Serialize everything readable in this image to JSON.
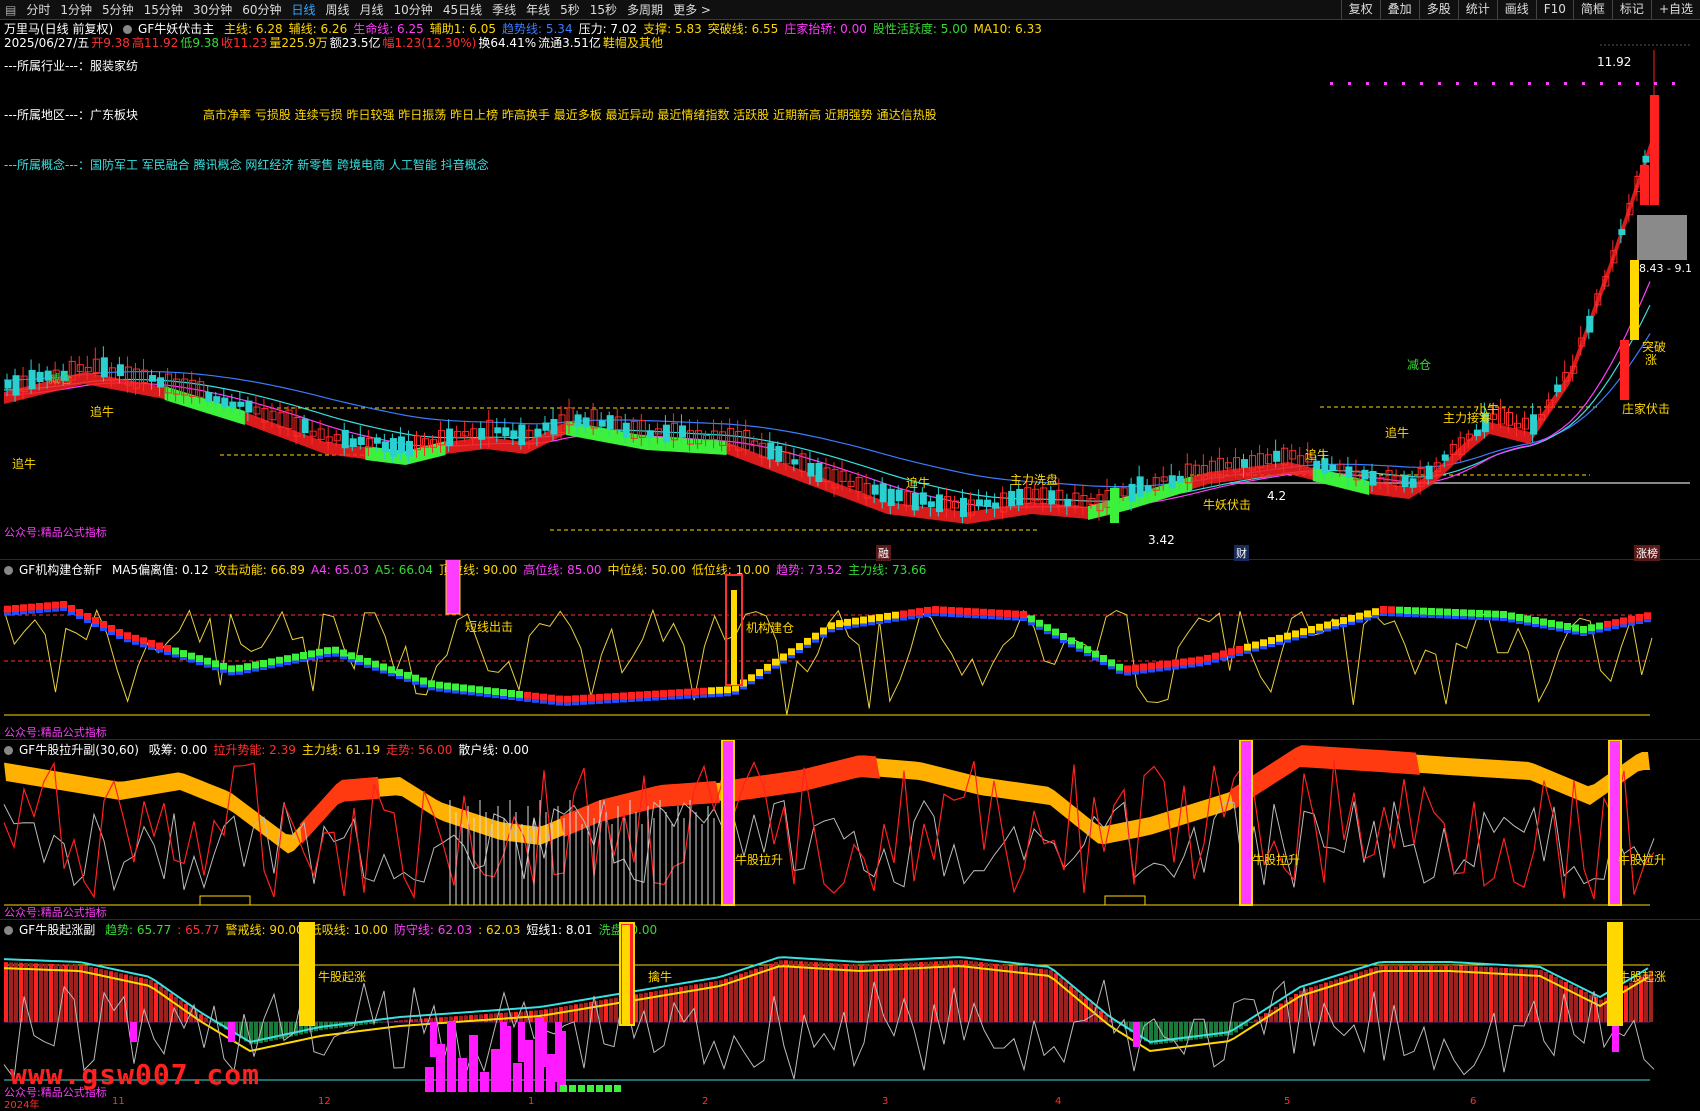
{
  "toolbar": {
    "periods": [
      "分时",
      "1分钟",
      "5分钟",
      "15分钟",
      "30分钟",
      "60分钟",
      "日线",
      "周线",
      "月线",
      "10分钟",
      "45日线",
      "季线",
      "年线",
      "5秒",
      "15秒",
      "多周期",
      "更多 >"
    ],
    "active_period": "日线",
    "right_buttons": [
      "复权",
      "叠加",
      "多股",
      "统计",
      "画线",
      "F10",
      "简框",
      "标记",
      "+自选"
    ]
  },
  "header": {
    "stock": "万里马(日线 前复权)",
    "indicator": "GF牛妖伏击主",
    "items": [
      {
        "label": "主线: 6.28",
        "color": "#ffd800"
      },
      {
        "label": "辅线: 6.26",
        "color": "#ffd800"
      },
      {
        "label": "生命线: 6.25",
        "color": "#ff3cff"
      },
      {
        "label": "辅助1: 6.05",
        "color": "#ffd800"
      },
      {
        "label": "趋势线: 5.34",
        "color": "#3a7cff"
      },
      {
        "label": "压力: 7.02",
        "color": "#ffffff"
      },
      {
        "label": "支撑: 5.83",
        "color": "#ffd800"
      },
      {
        "label": "突破线: 6.55",
        "color": "#ffd800"
      },
      {
        "label": "庄家抬轿: 0.00",
        "color": "#ff3cff"
      },
      {
        "label": "股性活跃度: 5.00",
        "color": "#36d936"
      },
      {
        "label": "MA10: 6.33",
        "color": "#ffd800"
      }
    ]
  },
  "quote": {
    "date": "2025/06/27/五",
    "open": "开9.38",
    "high": "高11.92",
    "low": "低9.38",
    "close": "收11.23",
    "volume": "量225.9万",
    "amount": "额23.5亿",
    "change": "幅1.23(12.30%)",
    "turnover": "换64.41%",
    "float": "流通3.51亿",
    "concept_tag": "鞋帽及其他"
  },
  "info_rows": {
    "industry_label": "---所属行业---：",
    "industry": "服装家纺",
    "region_label": "---所属地区---：",
    "region": "广东板块",
    "region_tags": "高市净率 亏损股 连续亏损 昨日较强 昨日振荡 昨日上榜 昨高换手 最近多板 最近异动 最近情绪指数 活跃股 近期新高 近期强势 通达信热股",
    "concept_label": "---所属概念---：",
    "concept": "国防军工 军民融合 腾讯概念 网红经济 新零售 跨境电商 人工智能 抖音概念"
  },
  "main_chart": {
    "price_high": "11.92",
    "price_low": "3.42",
    "low_mark": "4.2",
    "box_range": "8.43 - 9.1",
    "watermark": "公众号:精品公式指标",
    "signals": [
      "追牛",
      "追牛",
      "追牛",
      "牛妖伏击",
      "追牛",
      "追牛",
      "主力接筹",
      "小牛",
      "减仓",
      "减仓",
      "庄家伏击",
      "突破",
      "涨",
      "主力洗盘"
    ],
    "bottom_markers": [
      "融",
      "财",
      "涨榜"
    ],
    "colors": {
      "up": "#ff2a2a",
      "down": "#2ad0d0",
      "band_up": "#ff2020",
      "band_down": "#3cf03c"
    }
  },
  "panel1": {
    "title": "GF机构建仓新F",
    "items": [
      {
        "label": "MA5偏离值: 0.12",
        "color": "#ffffff"
      },
      {
        "label": "攻击动能: 66.89",
        "color": "#ffd800"
      },
      {
        "label": "A4: 65.03",
        "color": "#ff3cff"
      },
      {
        "label": "A5: 66.04",
        "color": "#36d936"
      },
      {
        "label": "顶位线: 90.00",
        "color": "#ffd800"
      },
      {
        "label": "高位线: 85.00",
        "color": "#ff3cff"
      },
      {
        "label": "中位线: 50.00",
        "color": "#ffd800"
      },
      {
        "label": "低位线: 10.00",
        "color": "#ffd800"
      },
      {
        "label": "趋势: 73.52",
        "color": "#ff3cff"
      },
      {
        "label": "主力线: 73.66",
        "color": "#36d936"
      }
    ],
    "labels": [
      "短线出击",
      "机构建仓"
    ],
    "watermark": "公众号:精品公式指标"
  },
  "panel2": {
    "title": "GF牛股拉升副(30,60)",
    "items": [
      {
        "label": "吸筹: 0.00",
        "color": "#ffffff"
      },
      {
        "label": "拉升势能: 2.39",
        "color": "#ff3030"
      },
      {
        "label": "主力线: 61.19",
        "color": "#ffd800"
      },
      {
        "label": "走势: 56.00",
        "color": "#ff3030"
      },
      {
        "label": "散户线: 0.00",
        "color": "#ffffff"
      }
    ],
    "labels": [
      "牛股拉升",
      "牛股拉升",
      "牛股拉升"
    ],
    "watermark": "公众号:精品公式指标"
  },
  "panel3": {
    "title": "GF牛股起涨副",
    "items": [
      {
        "label": "趋势: 65.77",
        "color": "#36d936"
      },
      {
        "label": ": 65.77",
        "color": "#ff3030"
      },
      {
        "label": "警戒线: 90.00",
        "color": "#ffd800"
      },
      {
        "label": "低吸线: 10.00",
        "color": "#ffd800"
      },
      {
        "label": "防守线: 62.03",
        "color": "#ff3cff"
      },
      {
        "label": ": 62.03",
        "color": "#ffd800"
      },
      {
        "label": "短线1: 8.01",
        "color": "#ffffff"
      },
      {
        "label": "洗盘: 0.00",
        "color": "#36d936"
      }
    ],
    "labels": [
      "牛股起涨",
      "擒牛",
      "牛股起涨"
    ],
    "watermark": "公众号:精品公式指标",
    "site_watermark": "www.gsw007.com"
  },
  "x_axis": [
    "2024年",
    "11",
    "12",
    "1",
    "2",
    "3",
    "4",
    "5",
    "6"
  ]
}
